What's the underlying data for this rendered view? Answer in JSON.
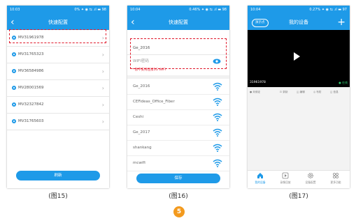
{
  "screens": [
    {
      "status_time": "10:03",
      "status_right": "0% ✦ ◉ ⇆ .ıl ▬ 98",
      "title": "快速配置",
      "devices": [
        "MV31961978",
        "MV31765323",
        "MV36584986",
        "MV28001569",
        "MV32327842",
        "MV31765603"
      ],
      "refresh_button": "刷新",
      "caption": "(图15)"
    },
    {
      "status_time": "10:04",
      "status_right": "0.46% ✦ ◉ ⇆ .ıl ▬ 98",
      "title": "快速配置",
      "ssid_value": "Ge_2016",
      "password_placeholder": "WIFI密码",
      "hint": "* 暂不支持连接5G WIFI",
      "networks": [
        "Ge_2016",
        "CEFideas_Office_Fiber",
        "Ceshi",
        "Ge_2017",
        "shankang",
        "mcwifi"
      ],
      "save_button": "保存",
      "caption": "(图16)"
    },
    {
      "status_time": "10:04",
      "status_right": "0.27% ✦ ◉ ⇆ .ıl ▬ 97",
      "title": "我的设备",
      "demo_tag": "演示点",
      "device_id": "31961978",
      "device_status": "● 在线",
      "controls": [
        "● 未绑定",
        "⊡ 录制",
        "◫ 编辑",
        "◎ 布防",
        "◫ 信息"
      ],
      "tabs": [
        "我的设备",
        "录像回放",
        "设备配置",
        "更多功能"
      ],
      "caption": "(图17)"
    }
  ],
  "page_number": "5",
  "colors": {
    "primary": "#1e9ae8",
    "highlight": "#e0182a",
    "badge": "#f39a1e"
  }
}
